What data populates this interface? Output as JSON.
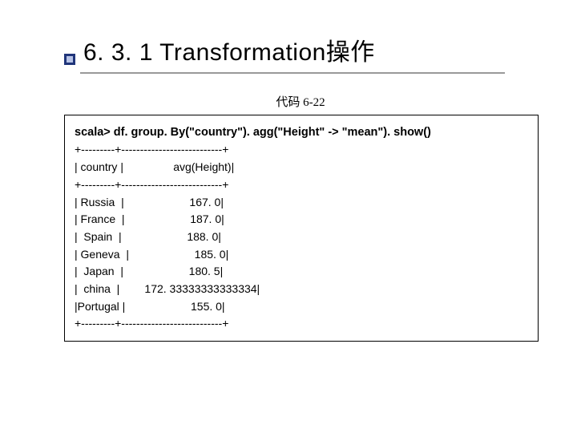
{
  "title": "6. 3. 1 Transformation操作",
  "caption": "代码 6-22",
  "command": "scala> df. group. By(\"country\"). agg(\"Height\" -> \"mean\"). show()",
  "output_header_avg": "avg(Height)",
  "output_header_country": "country",
  "rows": [
    {
      "country": "Russia",
      "value": "167. 0"
    },
    {
      "country": "France",
      "value": "187. 0"
    },
    {
      "country": "Spain",
      "value": "188. 0"
    },
    {
      "country": "Geneva",
      "value": "185. 0"
    },
    {
      "country": "Japan",
      "value": "180. 5"
    },
    {
      "country": "china",
      "value": "172. 33333333333334"
    },
    {
      "country": "Portugal",
      "value": "155. 0"
    }
  ],
  "chart_data": {
    "type": "table",
    "title": "avg(Height) by country",
    "columns": [
      "country",
      "avg(Height)"
    ],
    "rows": [
      [
        "Russia",
        167.0
      ],
      [
        "France",
        187.0
      ],
      [
        "Spain",
        188.0
      ],
      [
        "Geneva",
        185.0
      ],
      [
        "Japan",
        180.5
      ],
      [
        "china",
        172.33333333333334
      ],
      [
        "Portugal",
        155.0
      ]
    ]
  }
}
